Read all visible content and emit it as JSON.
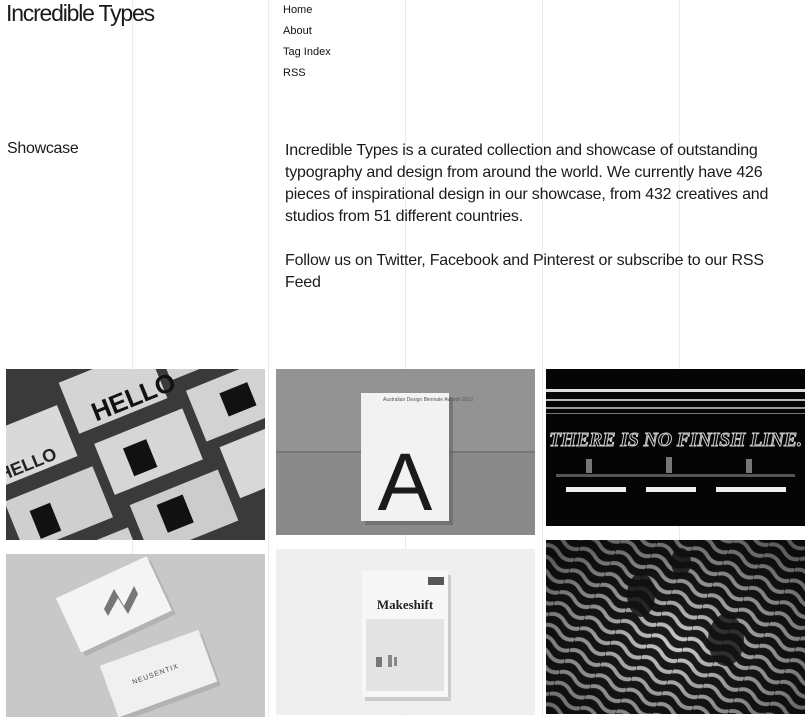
{
  "site": {
    "title": "Incredible Types"
  },
  "nav": {
    "items": [
      "Home",
      "About",
      "Tag Index",
      "RSS"
    ]
  },
  "section": {
    "label": "Showcase"
  },
  "intro": {
    "paragraph1": "Incredible Types is a curated collection and showcase of outstanding typography and design from around the world. We currently have 426 pieces of inspirational design in our showcase, from 432 creatives and studios from 51 different countries.",
    "paragraph2": "Follow us on Twitter, Facebook and Pinterest or subscribe to our RSS Feed"
  },
  "showcase": {
    "hello_text": "HELLO",
    "poster_title": "Australian Design Biennale Awards 2012",
    "poster_letter": "A",
    "finish_line_text": "THERE IS NO FINISH LINE.",
    "card_text": "NEUSENTIX",
    "magazine_title": "Makeshift"
  }
}
